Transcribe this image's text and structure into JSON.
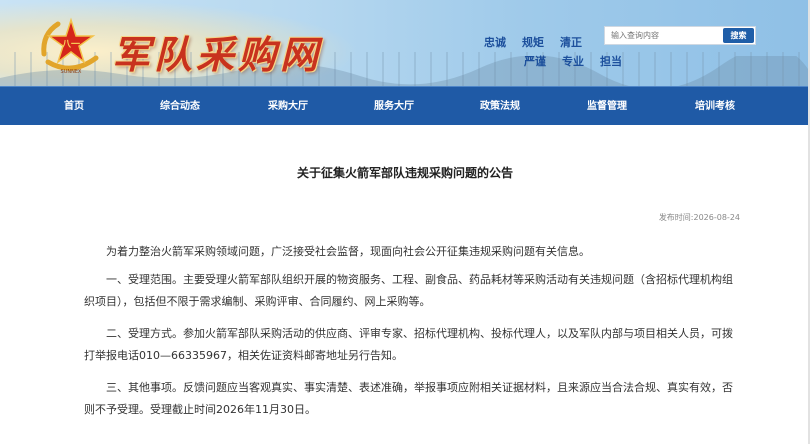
{
  "header": {
    "logo_text": "军队采购网",
    "emblem_label": "SUNNEX",
    "motto": [
      "忠诚",
      "规矩",
      "清正",
      "严谨",
      "专业",
      "担当"
    ],
    "search": {
      "placeholder": "输入查询内容",
      "button_label": "搜索"
    }
  },
  "nav": {
    "items": [
      {
        "label": "首页"
      },
      {
        "label": "综合动态"
      },
      {
        "label": "采购大厅"
      },
      {
        "label": "服务大厅"
      },
      {
        "label": "政策法规"
      },
      {
        "label": "监督管理"
      },
      {
        "label": "培训考核"
      }
    ]
  },
  "article": {
    "title": "关于征集火箭军部队违规采购问题的公告",
    "date": "发布时间:2026-08-24",
    "paragraphs": [
      "为着力整治火箭军采购领域问题，广泛接受社会监督，现面向社会公开征集违规采购问题有关信息。",
      "一、受理范围。主要受理火箭军部队组织开展的物资服务、工程、副食品、药品耗材等采购活动有关违规问题（含招标代理机构组织项目），包括但不限于需求编制、采购评审、合同履约、网上采购等。",
      "二、受理方式。参加火箭军部队采购活动的供应商、评审专家、招标代理机构、投标代理人，以及军队内部与项目相关人员，可拨打举报电话010—66335967，相关佐证资料邮寄地址另行告知。",
      "三、其他事项。反馈问题应当客观真实、事实清楚、表述准确，举报事项应附相关证据材料，且来源应当合法合规、真实有效，否则不予受理。受理截止时间2026年11月30日。"
    ]
  },
  "colors": {
    "nav_bg": "#1f5aa6",
    "logo_red": "#c8321e",
    "motto_blue": "#1c4f9c"
  }
}
